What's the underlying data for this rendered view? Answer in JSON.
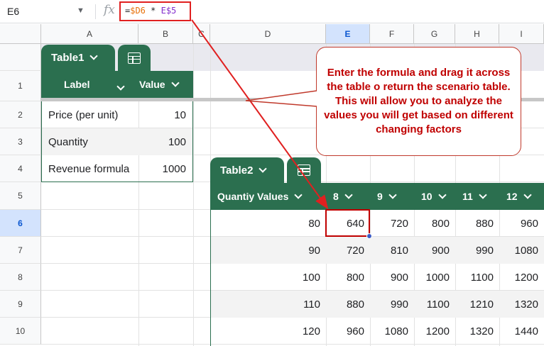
{
  "formula_bar": {
    "name_box": "E6",
    "fx_label": "fx",
    "formula_parts": [
      {
        "text": "=",
        "color": "#202124"
      },
      {
        "text": "$D6",
        "color": "#e8710a"
      },
      {
        "text": " * ",
        "color": "#202124"
      },
      {
        "text": "E$5",
        "color": "#8430ce"
      }
    ]
  },
  "columns": [
    "A",
    "B",
    "C",
    "D",
    "E",
    "F",
    "G",
    "H",
    "I"
  ],
  "rows": [
    "1",
    "2",
    "3",
    "4",
    "5",
    "6",
    "7",
    "8",
    "9",
    "10"
  ],
  "selected_cell": {
    "column": "E",
    "row": "6"
  },
  "table1": {
    "name": "Table1",
    "headers": [
      "Label",
      "Value"
    ],
    "rows": [
      {
        "label": "Price (per unit)",
        "value": "10"
      },
      {
        "label": "Quantity",
        "value": "100"
      },
      {
        "label": "Revenue formula",
        "value": "1000"
      }
    ]
  },
  "table2": {
    "name": "Table2",
    "header_first": "Quantiy Values",
    "headers": [
      "8",
      "9",
      "10",
      "11",
      "12"
    ],
    "rows": [
      {
        "qty": "80",
        "values": [
          "640",
          "720",
          "800",
          "880",
          "960"
        ]
      },
      {
        "qty": "90",
        "values": [
          "720",
          "810",
          "900",
          "990",
          "1080"
        ]
      },
      {
        "qty": "100",
        "values": [
          "800",
          "900",
          "1000",
          "1100",
          "1200"
        ]
      },
      {
        "qty": "110",
        "values": [
          "880",
          "990",
          "1100",
          "1210",
          "1320"
        ]
      },
      {
        "qty": "120",
        "values": [
          "960",
          "1080",
          "1200",
          "1320",
          "1440"
        ]
      }
    ]
  },
  "callout_text": "Enter the formula and drag it across the table o return the scenario table. This will allow you to analyze the values you will get based on different changing factors",
  "colors": {
    "table_header": "#2b6f4f",
    "annotation": "#e02020",
    "callout_text": "#c00000",
    "selection": "#0b57d0"
  }
}
